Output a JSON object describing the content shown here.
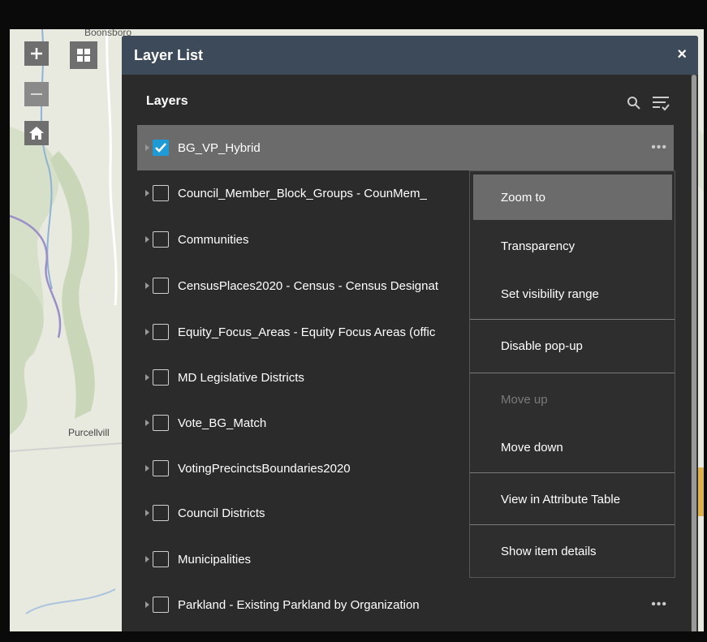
{
  "map": {
    "labels": {
      "boonsboro": "Boonsboro",
      "purcellville": "Purcellvill"
    }
  },
  "panel": {
    "title": "Layer List",
    "close": "×",
    "section_title": "Layers",
    "header_color": "#3c4a5a",
    "background_color": "#2b2b2b"
  },
  "layers": [
    {
      "name": "BG_VP_Hybrid",
      "checked": true
    },
    {
      "name": "Council_Member_Block_Groups - CounMem_",
      "checked": false
    },
    {
      "name": "Communities",
      "checked": false
    },
    {
      "name": "CensusPlaces2020 - Census - Census Designat",
      "checked": false
    },
    {
      "name": "Equity_Focus_Areas - Equity Focus Areas (offic",
      "checked": false
    },
    {
      "name": "MD Legislative Districts",
      "checked": false
    },
    {
      "name": "Vote_BG_Match",
      "checked": false
    },
    {
      "name": "VotingPrecinctsBoundaries2020",
      "checked": false
    },
    {
      "name": "Council Districts",
      "checked": false
    },
    {
      "name": "Municipalities",
      "checked": false
    },
    {
      "name": "Parkland - Existing Parkland by Organization",
      "checked": false
    }
  ],
  "more_label": "•••",
  "menu": {
    "items": [
      {
        "label": "Zoom to",
        "state": "highlighted"
      },
      {
        "label": "Transparency",
        "state": "enabled"
      },
      {
        "label": "Set visibility range",
        "state": "enabled"
      },
      {
        "label": "Disable pop-up",
        "state": "enabled"
      },
      {
        "label": "Move up",
        "state": "disabled"
      },
      {
        "label": "Move down",
        "state": "enabled"
      },
      {
        "label": "View in Attribute Table",
        "state": "enabled"
      },
      {
        "label": "Show item details",
        "state": "enabled"
      }
    ]
  },
  "icons": {
    "zoom_in": "plus-icon",
    "zoom_out": "minus-icon",
    "home": "home-icon",
    "basemap": "grid-icon",
    "search": "search-icon",
    "filter": "filter-list-icon",
    "check": "check-icon",
    "expand": "caret-right-icon"
  },
  "colors": {
    "accent_check": "#1e9bd7",
    "selected_row": "#6b6b6b"
  }
}
